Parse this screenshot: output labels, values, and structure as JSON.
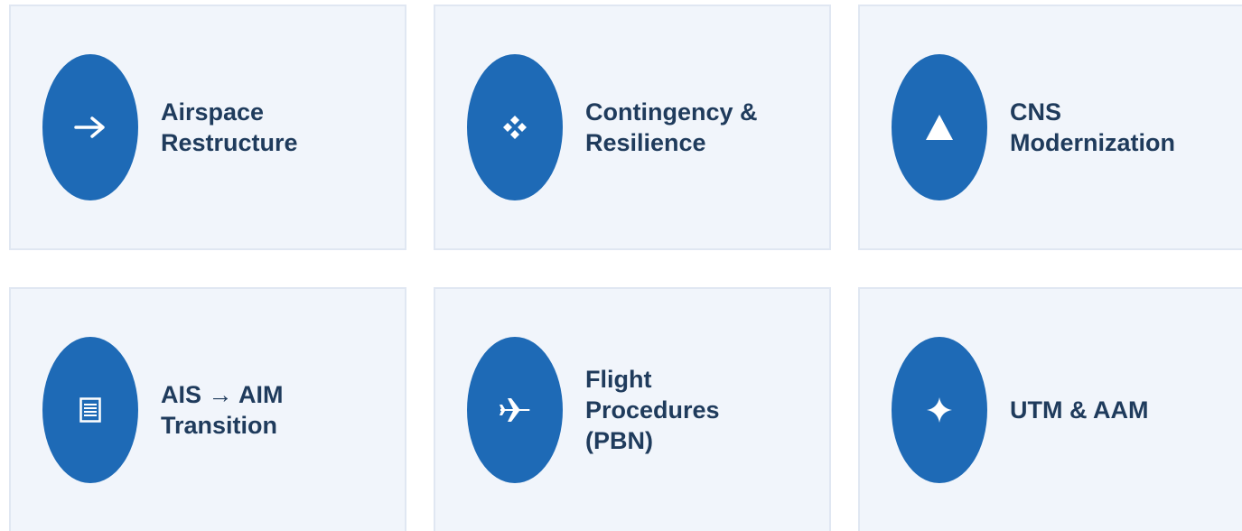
{
  "cards": [
    {
      "label": "Airspace\nRestructure",
      "icon": "arrow-right-icon"
    },
    {
      "label": "Contingency &\nResilience",
      "icon": "diamond-cluster-icon"
    },
    {
      "label": "CNS\nModernization",
      "icon": "triangle-icon"
    },
    {
      "label": "AIS → AIM\nTransition",
      "icon": "list-document-icon"
    },
    {
      "label": "Flight\nProcedures\n(PBN)",
      "icon": "airplane-icon"
    },
    {
      "label": "UTM & AAM",
      "icon": "four-point-star-icon"
    }
  ],
  "colors": {
    "card_bg": "#f1f5fb",
    "card_border": "#e0e7f2",
    "badge": "#1e6ab6",
    "text": "#1f3b5c"
  }
}
